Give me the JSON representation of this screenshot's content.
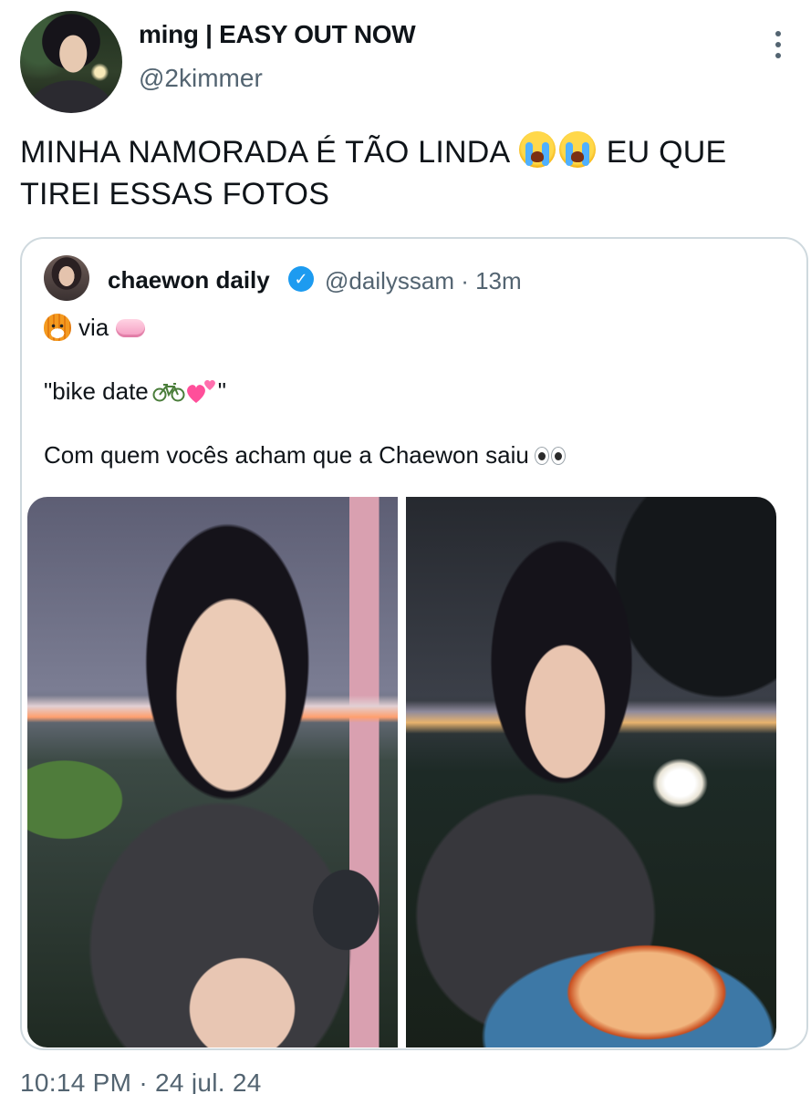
{
  "author": {
    "display_name": "ming | EASY OUT NOW",
    "handle": "@2kimmer"
  },
  "tweet": {
    "text_before": "MINHA NAMORADA É TÃO LINDA",
    "text_after": "EU QUE TIREI ESSAS FOTOS",
    "emoji": [
      "loudly-crying-face-icon",
      "loudly-crying-face-icon"
    ]
  },
  "quoted_tweet": {
    "display_name": "chaewon daily",
    "handle_time": "@dailyssam · 13m",
    "via_label": "via",
    "line2": "\"bike date",
    "line2_end": "\"",
    "line3": "Com quem vocês acham que a Chaewon saiu",
    "photos": [
      "photo-selfie-river",
      "photo-eating-ramen"
    ]
  },
  "timestamp": "10:14 PM · 24 jul. 24",
  "colors": {
    "text_primary": "#0f1419",
    "text_secondary": "#536471",
    "verified_blue": "#1d9bf0",
    "card_border": "#cfd9de"
  }
}
